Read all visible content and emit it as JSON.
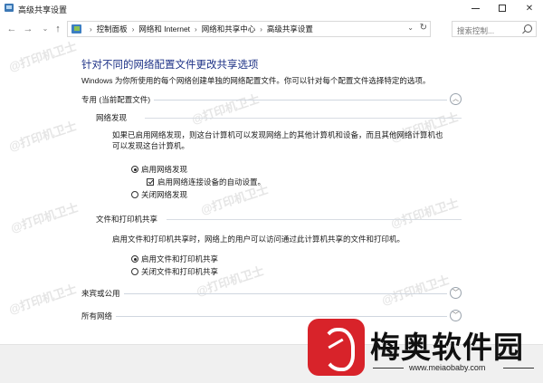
{
  "window": {
    "title": "高级共享设置",
    "icon": "control-panel-icon"
  },
  "navigation": {
    "breadcrumbs": [
      "控制面板",
      "网络和 Internet",
      "网络和共享中心",
      "高级共享设置"
    ],
    "search_placeholder": "搜索控制..."
  },
  "page": {
    "title": "针对不同的网络配置文件更改共享选项",
    "intro": "Windows 为你所使用的每个网络创建单独的网络配置文件。你可以针对每个配置文件选择特定的选项。"
  },
  "profiles": {
    "private": {
      "label": "专用 (当前配置文件)",
      "state": "expanded",
      "network_discovery": {
        "label": "网络发现",
        "description_line1": "如果已启用网络发现，则这台计算机可以发现网络上的其他计算机和设备，而且其他网络计算机也",
        "description_line2": "可以发现这台计算机。",
        "options": [
          "启用网络发现",
          "关闭网络发现"
        ],
        "selected": "启用网络发现",
        "auto_setup_label": "启用网络连接设备的自动设置。",
        "auto_setup_checked": true
      },
      "file_printer_sharing": {
        "label": "文件和打印机共享",
        "description": "启用文件和打印机共享时，网络上的用户可以访问通过此计算机共享的文件和打印机。",
        "options": [
          "启用文件和打印机共享",
          "关闭文件和打印机共享"
        ],
        "selected": "启用文件和打印机共享"
      }
    },
    "guest_public": {
      "label": "来宾或公用",
      "state": "collapsed"
    },
    "all_networks": {
      "label": "所有网络",
      "state": "collapsed"
    }
  },
  "watermark": "@打印机卫士",
  "branding": {
    "name": "梅奥软件园",
    "url": "www.meiaobaby.com",
    "accent": "#d8232a"
  },
  "colors": {
    "title_blue": "#1e3287",
    "footer_bg": "#f0f0f0"
  }
}
